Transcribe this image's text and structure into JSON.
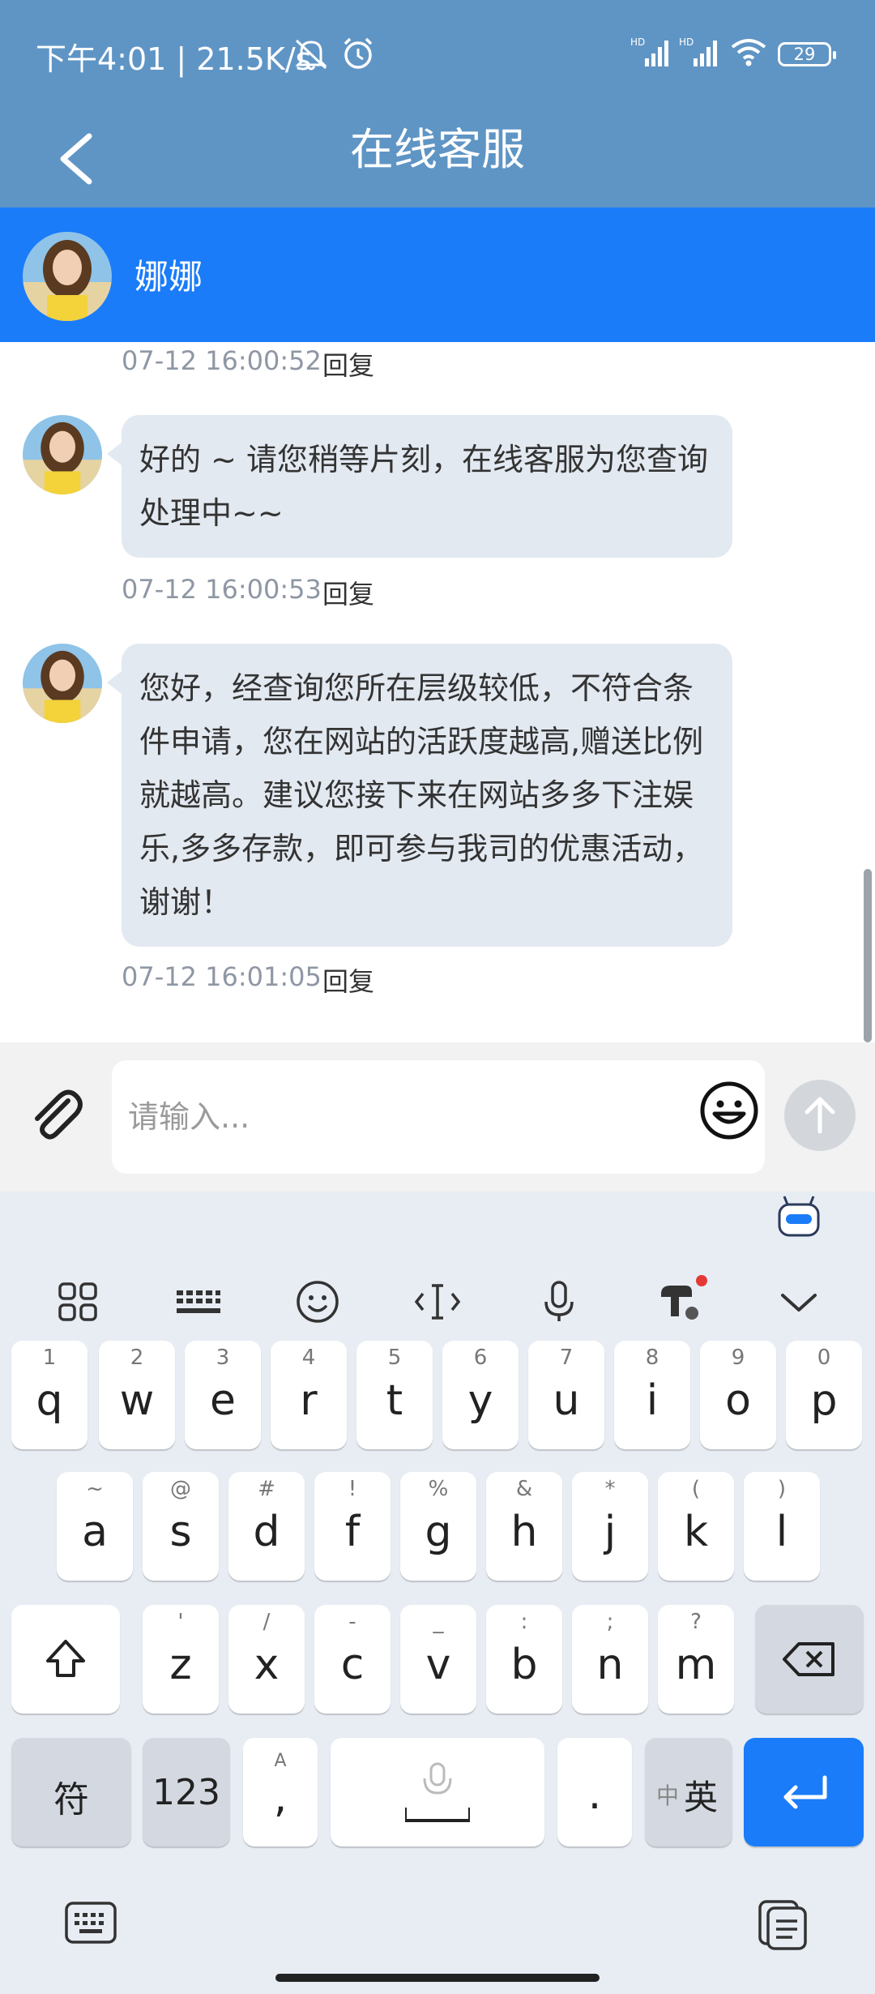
{
  "status_bar": {
    "time_speed": "下午4:01 | 21.5K/s",
    "signal_1": "HD",
    "signal_2": "HD",
    "battery": "29"
  },
  "header": {
    "title": "在线客服"
  },
  "agent": {
    "name": "娜娜"
  },
  "messages": [
    {
      "timestamp": "07-12 16:00:52",
      "reply_label": "回复"
    },
    {
      "text": "好的 ~ 请您稍等片刻，在线客服为您查询处理中~~",
      "timestamp": "07-12 16:00:53",
      "reply_label": "回复"
    },
    {
      "text": "您好，经查询您所在层级较低，不符合条件申请，您在网站的活跃度越高,赠送比例就越高。建议您接下来在网站多多下注娱乐,多多存款，即可参与我司的优惠活动，谢谢！",
      "timestamp": "07-12 16:01:05",
      "reply_label": "回复"
    }
  ],
  "input": {
    "placeholder": "请输入..."
  },
  "keyboard": {
    "row1": [
      {
        "main": "q",
        "sub": "1"
      },
      {
        "main": "w",
        "sub": "2"
      },
      {
        "main": "e",
        "sub": "3"
      },
      {
        "main": "r",
        "sub": "4"
      },
      {
        "main": "t",
        "sub": "5"
      },
      {
        "main": "y",
        "sub": "6"
      },
      {
        "main": "u",
        "sub": "7"
      },
      {
        "main": "i",
        "sub": "8"
      },
      {
        "main": "o",
        "sub": "9"
      },
      {
        "main": "p",
        "sub": "0"
      }
    ],
    "row2": [
      {
        "main": "a",
        "sub": "~"
      },
      {
        "main": "s",
        "sub": "@"
      },
      {
        "main": "d",
        "sub": "#"
      },
      {
        "main": "f",
        "sub": "!"
      },
      {
        "main": "g",
        "sub": "%"
      },
      {
        "main": "h",
        "sub": "&"
      },
      {
        "main": "j",
        "sub": "*"
      },
      {
        "main": "k",
        "sub": "("
      },
      {
        "main": "l",
        "sub": ")"
      }
    ],
    "row3": [
      {
        "main": "z",
        "sub": "'"
      },
      {
        "main": "x",
        "sub": "/"
      },
      {
        "main": "c",
        "sub": "-"
      },
      {
        "main": "v",
        "sub": "_"
      },
      {
        "main": "b",
        "sub": ":"
      },
      {
        "main": "n",
        "sub": ";"
      },
      {
        "main": "m",
        "sub": "?"
      }
    ],
    "symbol_key": "符",
    "number_key": "123",
    "comma_key": ",",
    "comma_sub": "A",
    "period_key": ".",
    "lang_small": "中",
    "lang_big": "英"
  },
  "colors": {
    "header_bg": "#5f95c5",
    "agent_bar_bg": "#1a7cf9",
    "bubble_bg": "#e3e9f1",
    "enter_key": "#1a7cf9"
  }
}
